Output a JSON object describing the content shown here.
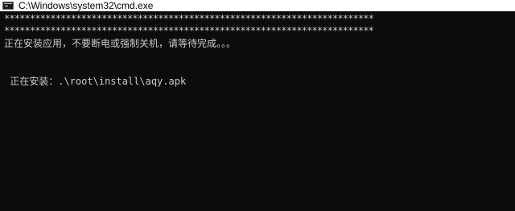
{
  "window": {
    "title": "C:\\Windows\\system32\\cmd.exe",
    "icon": "cmd-icon"
  },
  "console": {
    "lines": [
      "************************************************************************",
      "************************************************************************",
      "正在安装应用，不要断电或强制关机，请等待完成。。。",
      "",
      " 正在安装：.\\root\\install\\aqy.apk"
    ]
  },
  "colors": {
    "background": "#0c0c0c",
    "text": "#cccccc",
    "titlebar": "#ffffff"
  }
}
